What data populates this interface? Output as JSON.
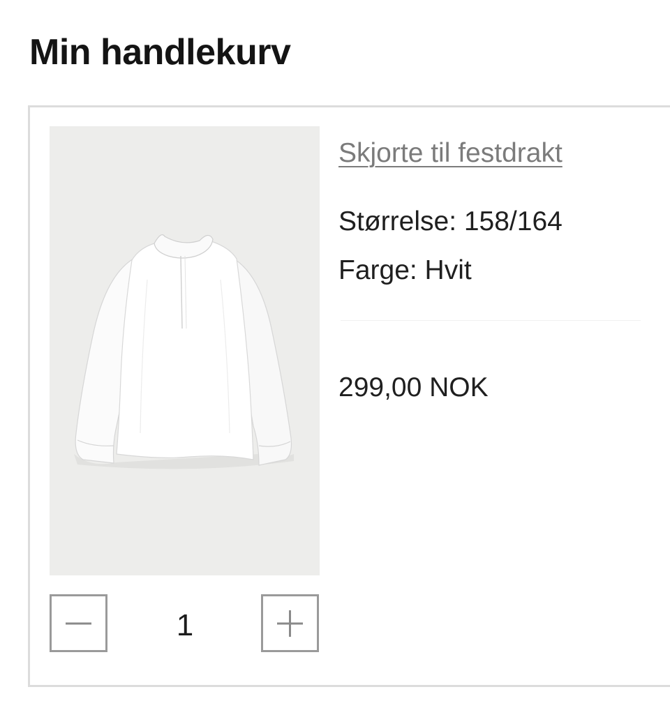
{
  "page": {
    "title": "Min handlekurv"
  },
  "cart_item": {
    "product_name": "Skjorte til festdrakt",
    "size_text": "Størrelse: 158/164",
    "color_text": "Farge: Hvit",
    "price_text": "299,00 NOK",
    "image_icon": "white-shirt-image",
    "quantity": {
      "value": "1",
      "minus_icon": "minus-icon",
      "plus_icon": "plus-icon"
    }
  },
  "colors": {
    "title": "#141414",
    "link": "#7b7b7b",
    "border": "#dcdcdc",
    "image_bg": "#ededeb",
    "button_border": "#9a9a9a"
  }
}
